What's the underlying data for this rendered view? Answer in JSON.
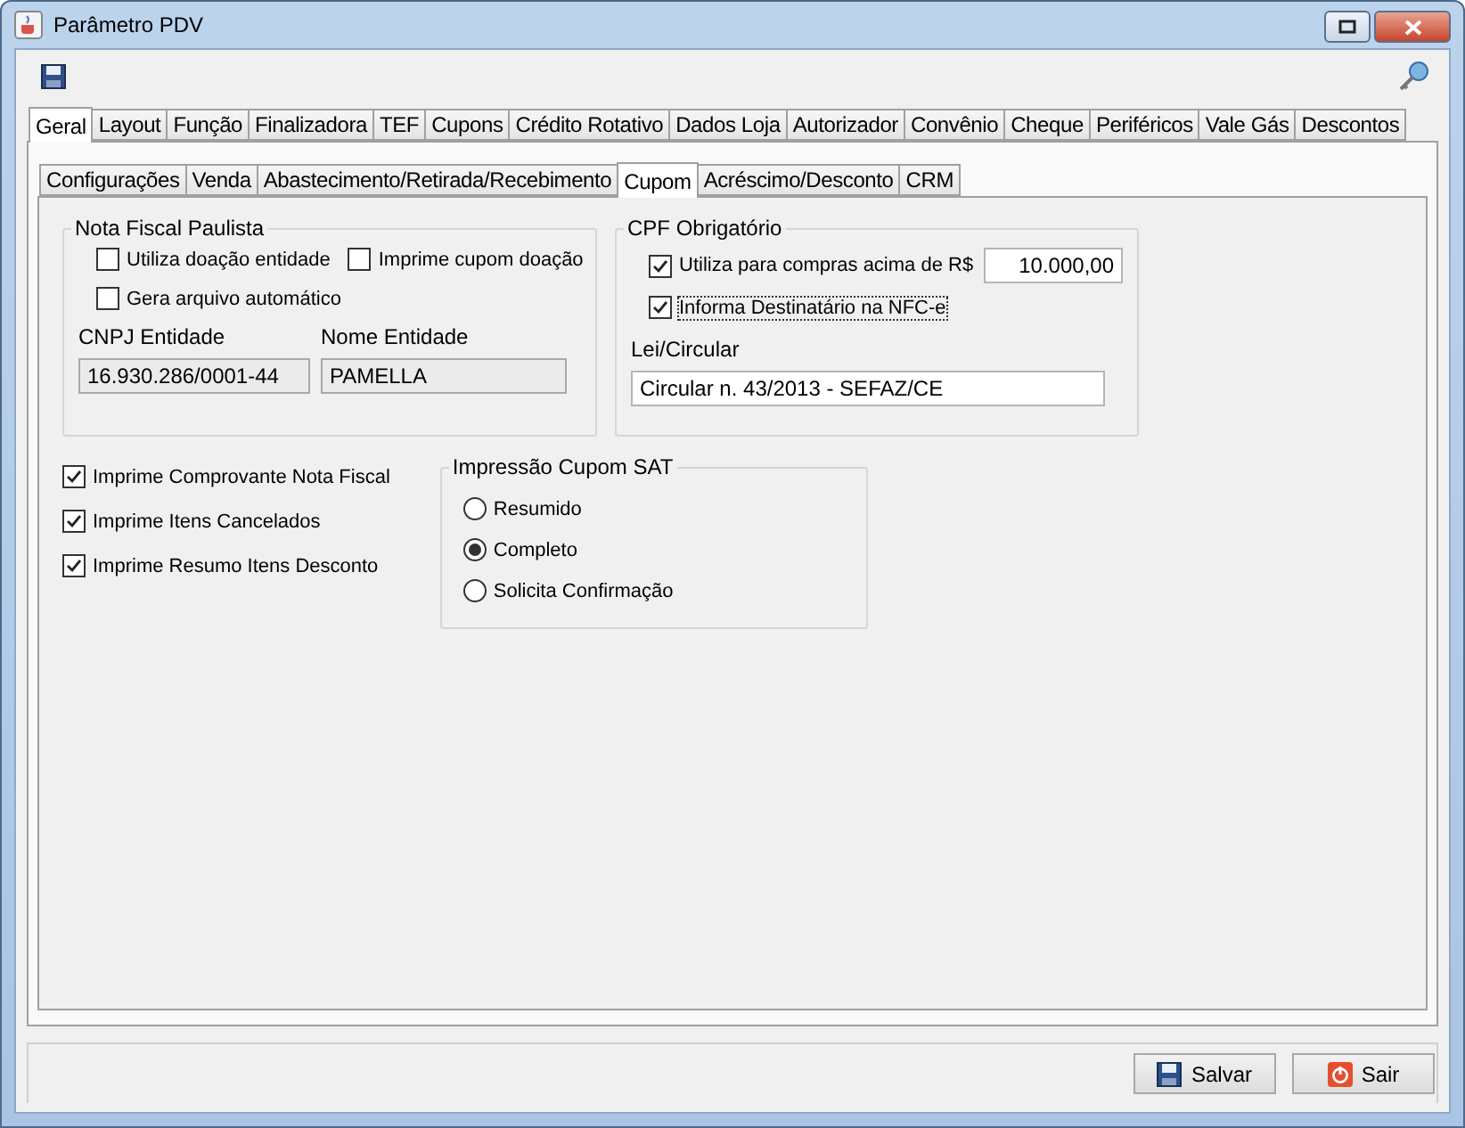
{
  "window": {
    "title": "Parâmetro PDV"
  },
  "tabs": [
    {
      "label": "Geral",
      "selected": true
    },
    {
      "label": "Layout",
      "selected": false
    },
    {
      "label": "Função",
      "selected": false
    },
    {
      "label": "Finalizadora",
      "selected": false
    },
    {
      "label": "TEF",
      "selected": false
    },
    {
      "label": "Cupons",
      "selected": false
    },
    {
      "label": "Crédito Rotativo",
      "selected": false
    },
    {
      "label": "Dados Loja",
      "selected": false
    },
    {
      "label": "Autorizador",
      "selected": false
    },
    {
      "label": "Convênio",
      "selected": false
    },
    {
      "label": "Cheque",
      "selected": false
    },
    {
      "label": "Periféricos",
      "selected": false
    },
    {
      "label": "Vale Gás",
      "selected": false
    },
    {
      "label": "Descontos",
      "selected": false
    }
  ],
  "subtabs": [
    {
      "label": "Configurações",
      "selected": false
    },
    {
      "label": "Venda",
      "selected": false
    },
    {
      "label": "Abastecimento/Retirada/Recebimento",
      "selected": false
    },
    {
      "label": "Cupom",
      "selected": true
    },
    {
      "label": "Acréscimo/Desconto",
      "selected": false
    },
    {
      "label": "CRM",
      "selected": false
    }
  ],
  "nota_fiscal_paulista": {
    "title": "Nota Fiscal Paulista",
    "options": [
      {
        "label": "Utiliza doação entidade",
        "checked": false
      },
      {
        "label": "Imprime cupom doação",
        "checked": false
      },
      {
        "label": "Gera arquivo automático",
        "checked": false
      }
    ],
    "fields": [
      {
        "label": "CNPJ Entidade",
        "value": "16.930.286/0001-44"
      },
      {
        "label": "Nome Entidade",
        "value": "PAMELLA"
      }
    ]
  },
  "cpf_obrigatorio": {
    "title": "CPF Obrigatório",
    "options": [
      {
        "label": "Utiliza para compras acima de R$",
        "checked": true,
        "value": "10.000,00"
      },
      {
        "label": "Informa Destinatário na NFC-e",
        "checked": true,
        "focused": true
      }
    ],
    "field": {
      "label": "Lei/Circular",
      "value": "Circular n. 43/2013 - SEFAZ/CE"
    }
  },
  "print_options": [
    {
      "label": "Imprime Comprovante Nota Fiscal",
      "checked": true
    },
    {
      "label": "Imprime Itens Cancelados",
      "checked": true
    },
    {
      "label": "Imprime Resumo Itens Desconto",
      "checked": true
    }
  ],
  "impressao_cupom_sat": {
    "title": "Impressão Cupom SAT",
    "options": [
      {
        "label": "Resumido",
        "selected": false
      },
      {
        "label": "Completo",
        "selected": true
      },
      {
        "label": "Solicita Confirmação",
        "selected": false
      }
    ]
  },
  "buttons": [
    {
      "label": "Salvar",
      "kind": "save"
    },
    {
      "label": "Sair",
      "kind": "exit"
    }
  ]
}
